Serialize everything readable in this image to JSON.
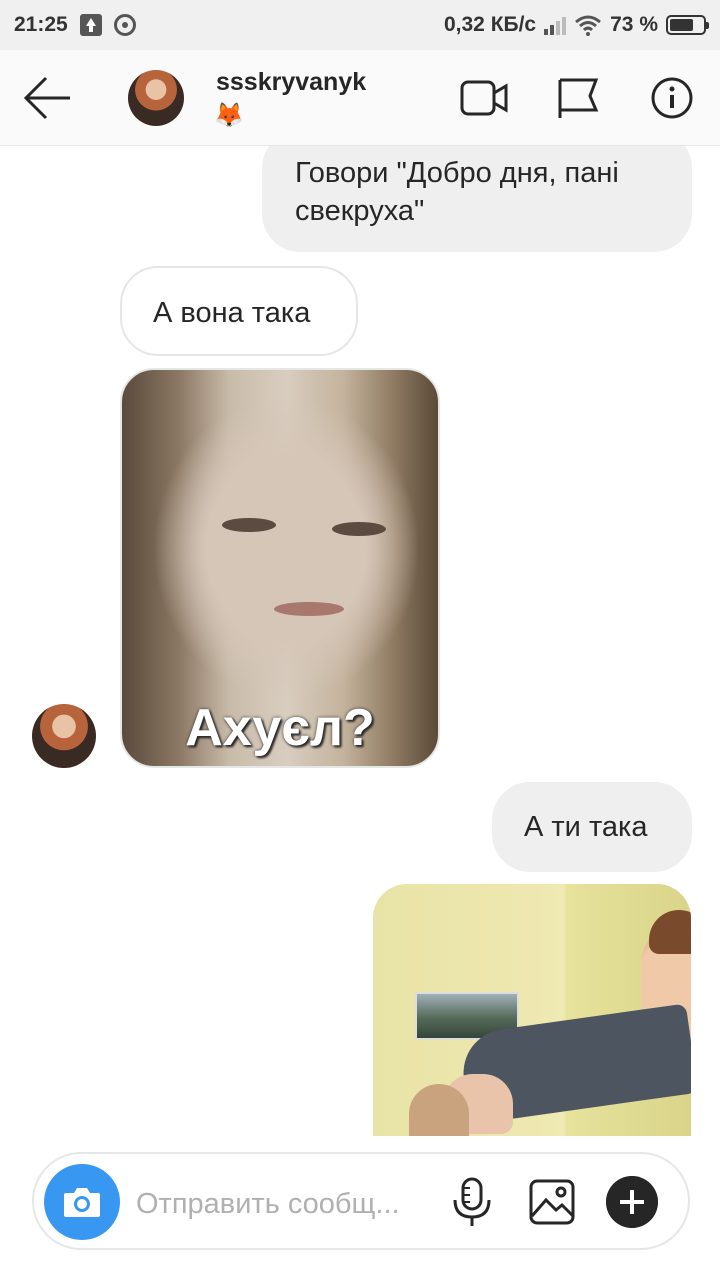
{
  "status_bar": {
    "time": "21:25",
    "network_speed": "0,32 КБ/с",
    "battery_percent": "73 %",
    "battery_level": 0.73
  },
  "header": {
    "username": "ssskryvanyk",
    "status_emoji": "🦊",
    "icons": [
      "arrow-left-icon",
      "video-camera-icon",
      "flag-icon",
      "info-icon"
    ]
  },
  "messages": [
    {
      "direction": "outgoing",
      "type": "text",
      "text": "Говори \"Добро дня, пані свекруха\""
    },
    {
      "direction": "incoming",
      "type": "text",
      "text": "А вона така"
    },
    {
      "direction": "incoming",
      "type": "image",
      "caption": "Ахуєл?"
    },
    {
      "direction": "outgoing",
      "type": "text",
      "text": "А ти така"
    },
    {
      "direction": "outgoing",
      "type": "image"
    }
  ],
  "composer": {
    "placeholder": "Отправить сообщ...",
    "icons": [
      "camera-icon",
      "microphone-icon",
      "gallery-icon",
      "plus-icon"
    ],
    "accent_color": "#3897f0"
  }
}
